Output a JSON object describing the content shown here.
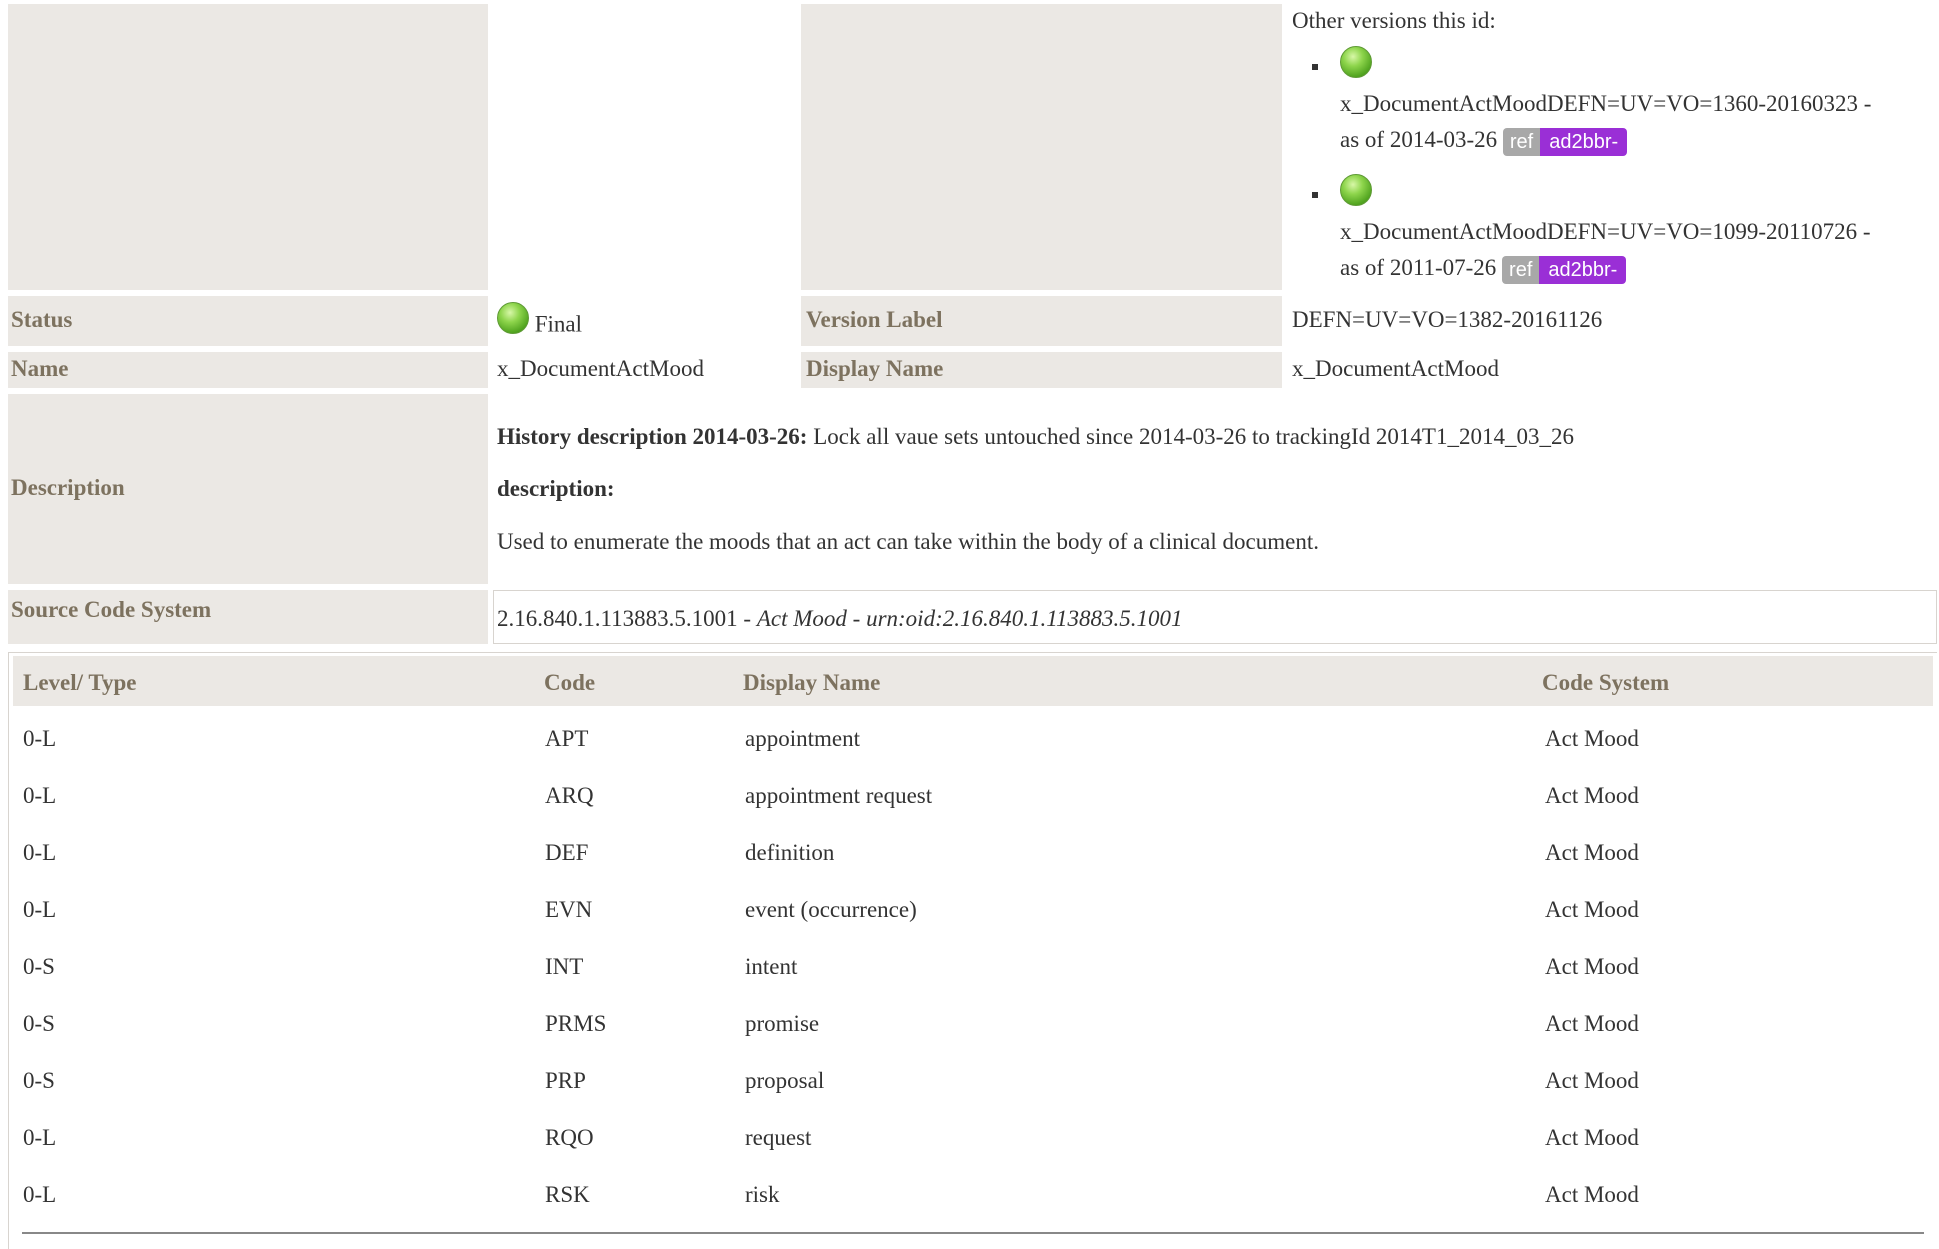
{
  "versions": {
    "title": "Other versions this id:",
    "items": [
      {
        "name": "x_DocumentActMoodDEFN=UV=VO=1360-20160323 -",
        "asof": "as of 2014-03-26",
        "badge_ref": "ref",
        "badge_project": "ad2bbr-"
      },
      {
        "name": "x_DocumentActMoodDEFN=UV=VO=1099-20110726 -",
        "asof": "as of 2011-07-26",
        "badge_ref": "ref",
        "badge_project": "ad2bbr-"
      }
    ]
  },
  "status": {
    "label": "Status",
    "value": "Final"
  },
  "version_label": {
    "label": "Version Label",
    "value": "DEFN=UV=VO=1382-20161126"
  },
  "name": {
    "label": "Name",
    "value": "x_DocumentActMood"
  },
  "display_name": {
    "label": "Display Name",
    "value": "x_DocumentActMood"
  },
  "description": {
    "label": "Description",
    "history_label": "History description 2014-03-26:",
    "history_text": " Lock all vaue sets untouched since 2014-03-26 to trackingId 2014T1_2014_03_26",
    "desc_label": "description:",
    "desc_text": "Used to enumerate the moods that an act can take within the body of a clinical document."
  },
  "source_code_system": {
    "label": "Source Code System",
    "oid": "2.16.840.1.113883.5.1001",
    "sep1": " - ",
    "name": "Act Mood",
    "sep2": " - ",
    "urn": "urn:oid:2.16.840.1.113883.5.1001"
  },
  "table": {
    "headers": [
      "Level/ Type",
      "Code",
      "Display Name",
      "Code System"
    ],
    "rows": [
      [
        "0-L",
        "APT",
        "appointment",
        "Act Mood"
      ],
      [
        "0-L",
        "ARQ",
        "appointment request",
        "Act Mood"
      ],
      [
        "0-L",
        "DEF",
        "definition",
        "Act Mood"
      ],
      [
        "0-L",
        "EVN",
        "event (occurrence)",
        "Act Mood"
      ],
      [
        "0-S",
        "INT",
        "intent",
        "Act Mood"
      ],
      [
        "0-S",
        "PRMS",
        "promise",
        "Act Mood"
      ],
      [
        "0-S",
        "PRP",
        "proposal",
        "Act Mood"
      ],
      [
        "0-L",
        "RQO",
        "request",
        "Act Mood"
      ],
      [
        "0-L",
        "RSK",
        "risk",
        "Act Mood"
      ]
    ]
  }
}
